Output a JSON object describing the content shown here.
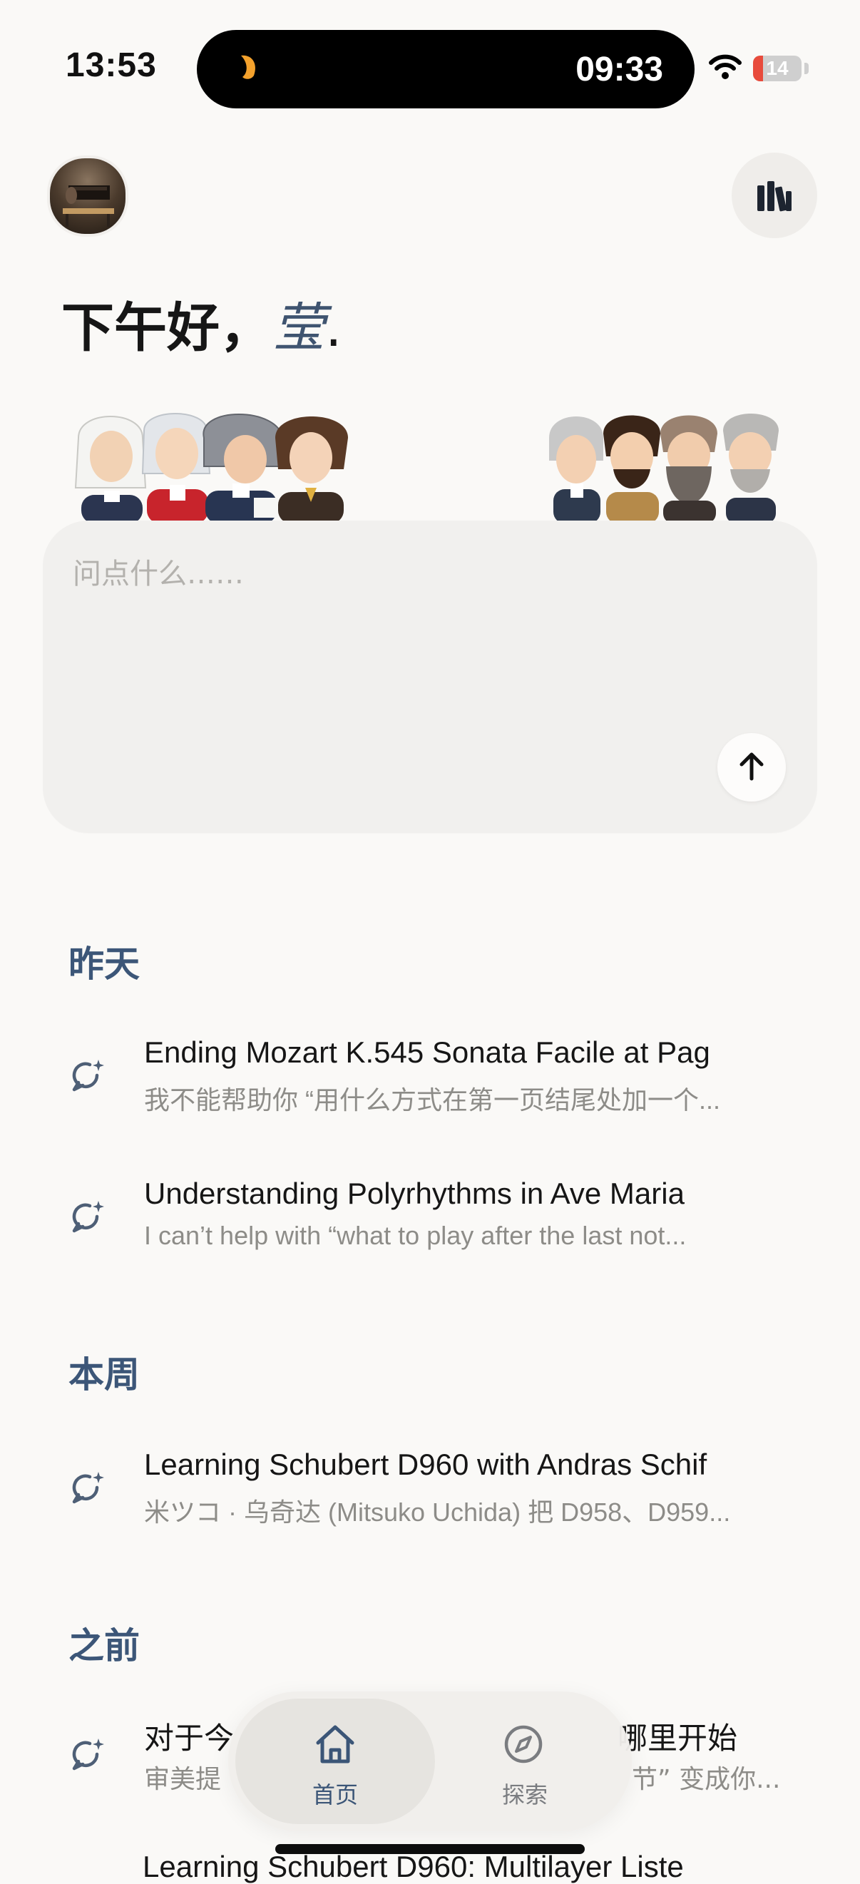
{
  "status_bar": {
    "time": "13:53",
    "island_time": "09:33",
    "battery": "14"
  },
  "header": {
    "greeting": "下午好，",
    "name": "莹",
    "punct": "."
  },
  "composer": {
    "placeholder": "问点什么……"
  },
  "sections": [
    {
      "title": "昨天",
      "items": [
        {
          "title": "Ending Mozart K.545 Sonata Facile at Pag",
          "subtitle": "我不能帮助你 “用什么方式在第一页结尾处加一个..."
        },
        {
          "title": "Understanding Polyrhythms in Ave Maria",
          "subtitle": "I can’t help with “what to play after the last not..."
        }
      ]
    },
    {
      "title": "本周",
      "items": [
        {
          "title": "Learning Schubert D960 with Andras Schif",
          "subtitle": "米ツコ · 乌奇达 (Mitsuko Uchida) 把 D958、D959..."
        }
      ]
    },
    {
      "title": "之前",
      "items": [
        {
          "title": "对于今",
          "title_tail": "哪里开始",
          "subtitle": "审美提",
          "subtitle_tail": "节” 变成你..."
        }
      ]
    }
  ],
  "peek_text": "Learning Schubert D960: Multilayer Liste",
  "bottom_nav": {
    "home": "首页",
    "explore": "探索"
  },
  "colors": {
    "accent": "#3c5678",
    "background": "#faf9f7"
  }
}
